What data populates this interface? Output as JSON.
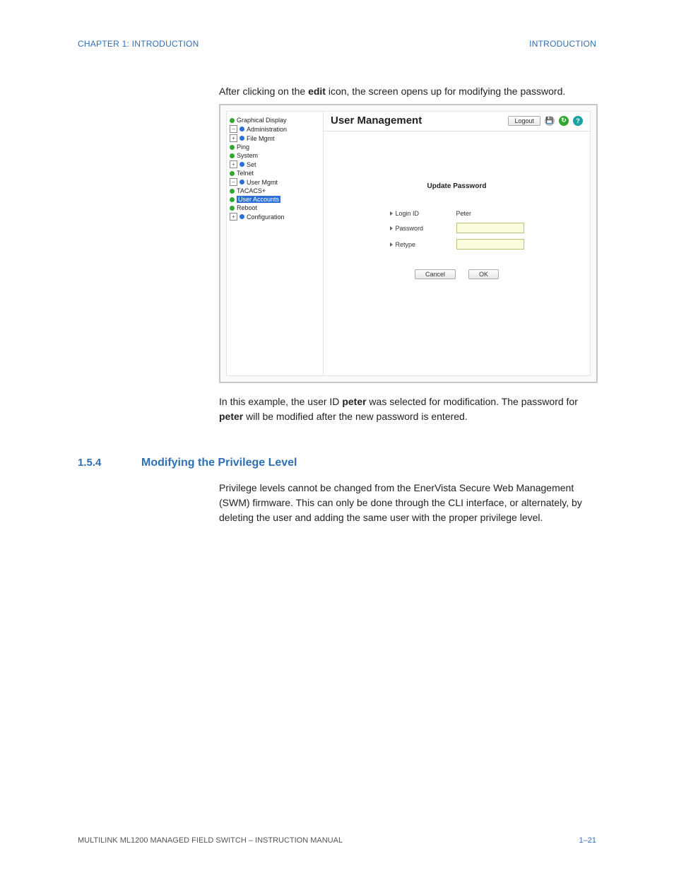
{
  "header": {
    "left": "CHAPTER 1: INTRODUCTION",
    "right": "INTRODUCTION"
  },
  "text": {
    "intro_pre": "After clicking on the ",
    "intro_bold": "edit",
    "intro_post": " icon, the screen opens up for modifying the password.",
    "para2_a": "In this example, the user ID ",
    "para2_b": "peter",
    "para2_c": " was selected for modification. The password for ",
    "para2_d": "peter",
    "para2_e": " will be modified after the new password is entered.",
    "sec_num": "1.5.4",
    "sec_title": "Modifying the Privilege Level",
    "para3": "Privilege levels cannot be changed from the EnerVista Secure Web Management (SWM) firmware. This can only be done through the CLI interface, or alternately, by deleting the user and adding the same user with the proper privilege level."
  },
  "screenshot": {
    "nav": {
      "graphical": "Graphical Display",
      "admin": "Administration",
      "filemgmt": "File Mgmt",
      "ping": "Ping",
      "system": "System",
      "set": "Set",
      "telnet": "Telnet",
      "usermgmt": "User Mgmt",
      "tacacs": "TACACS+",
      "useraccounts": "User Accounts",
      "reboot": "Reboot",
      "config": "Configuration"
    },
    "pane": {
      "title": "User Management",
      "logout": "Logout",
      "form_title": "Update Password",
      "login_label": "Login ID",
      "login_value": "Peter",
      "password_label": "Password",
      "retype_label": "Retype",
      "cancel": "Cancel",
      "ok": "OK"
    },
    "icons": {
      "save": "S",
      "refresh": "↻",
      "help": "?"
    }
  },
  "footer": {
    "left": "MULTILINK ML1200 MANAGED FIELD SWITCH – INSTRUCTION MANUAL",
    "right": "1–21"
  }
}
